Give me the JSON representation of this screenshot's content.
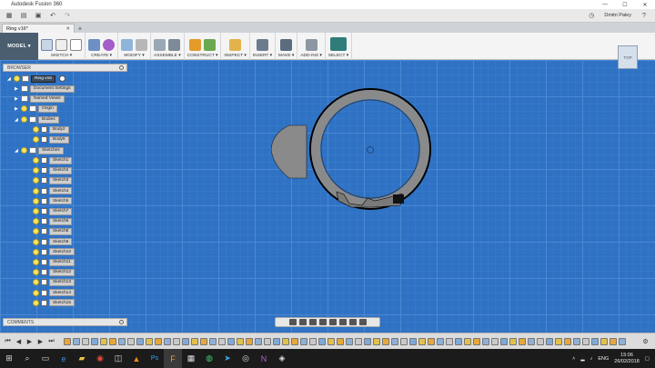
{
  "window": {
    "title": "Autodesk Fusion 360",
    "minimize": "—",
    "maximize": "☐",
    "close": "✕"
  },
  "qat": {
    "user": "Dmitri Paley"
  },
  "doc_tab": {
    "label": "Ring v16*",
    "close": "✕",
    "new": "+"
  },
  "ribbon": {
    "workspace": "MODEL ▾",
    "groups": [
      {
        "label": "SKETCH ▾"
      },
      {
        "label": "CREATE ▾"
      },
      {
        "label": "MODIFY ▾"
      },
      {
        "label": "ASSEMBLE ▾"
      },
      {
        "label": "CONSTRUCT ▾"
      },
      {
        "label": "INSPECT ▾"
      },
      {
        "label": "INSERT ▾"
      },
      {
        "label": "MAKE ▾"
      },
      {
        "label": "ADD-INS ▾"
      },
      {
        "label": "SELECT ▾"
      }
    ]
  },
  "browser": {
    "title": "BROWSER",
    "root": "Ring v16",
    "document_settings": "Document Settings",
    "named_views": "Named Views",
    "origin": "Origin",
    "bodies": "Bodies",
    "body_items": [
      "Body2",
      "Body5"
    ],
    "sketches": "Sketches",
    "sketch_items": [
      "Sketch1",
      "Sketch2",
      "Sketch3",
      "Sketch4",
      "Sketch5",
      "Sketch7",
      "Sketch6",
      "Sketch8",
      "Sketch9",
      "Sketch10",
      "Sketch11",
      "Sketch12",
      "Sketch13",
      "Sketch14",
      "Sketch15"
    ]
  },
  "comments": {
    "title": "COMMENTS"
  },
  "viewcube": {
    "face": "TOP"
  },
  "taskbar": {
    "language": "ENG",
    "time": "15:06",
    "date": "26/02/2018"
  },
  "colors": {
    "canvas": "#2f72c4",
    "grid": "#4a88d2",
    "ring_fill": "#8a8a8a",
    "ring_edge": "#000000",
    "browser_tag": "#cfcfcf"
  }
}
